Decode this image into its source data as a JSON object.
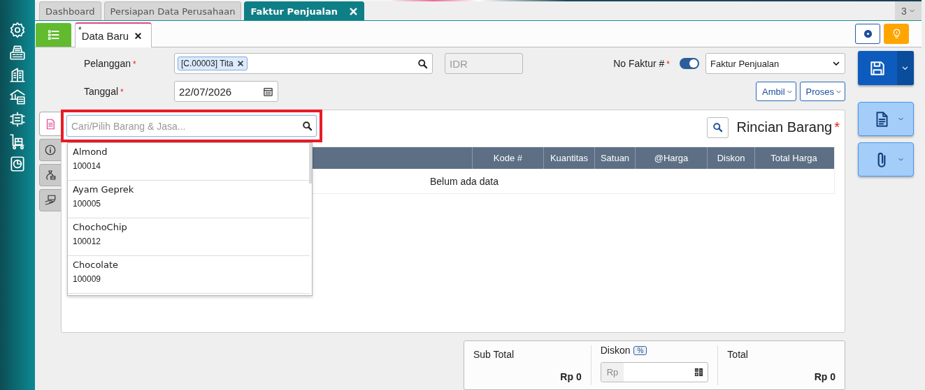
{
  "tabs": [
    {
      "label": "Dashboard",
      "selected": false
    },
    {
      "label": "Persiapan Data Perusahaan",
      "selected": false
    },
    {
      "label": "Faktur Penjualan",
      "selected": true
    }
  ],
  "tab_count": "3",
  "subtab": {
    "label": "Data Baru",
    "modified_mark": "*",
    "selected": true
  },
  "form": {
    "customer": {
      "label": "Pelanggan",
      "required_mark": "*",
      "tag": "[C.00003] Tita"
    },
    "currency": {
      "value": "IDR",
      "disabled": true
    },
    "invoice_no": {
      "label": "No Faktur #",
      "required_mark": "*",
      "auto": true,
      "value": "Faktur Penjualan"
    },
    "date": {
      "label": "Tanggal",
      "required_mark": "*",
      "value": "22/07/2026"
    }
  },
  "action_buttons": [
    "Ambil",
    "Proses"
  ],
  "side_tabs": [
    {
      "selected": true
    },
    {
      "selected": false
    },
    {
      "selected": false
    },
    {
      "selected": false
    }
  ],
  "items_panel": {
    "title": "Rincian Barang",
    "required_mark": "*",
    "columns": [
      "Kode #",
      "Kuantitas",
      "Satuan",
      "@Harga",
      "Diskon",
      "Total Harga"
    ],
    "empty_text": "Belum ada data"
  },
  "item_search": {
    "placeholder": "Cari/Pilih Barang & Jasa...",
    "highlighted": true,
    "results": [
      {
        "name": "Almond",
        "code": "100014"
      },
      {
        "name": "Ayam Geprek",
        "code": "100005"
      },
      {
        "name": "ChochoChip",
        "code": "100012"
      },
      {
        "name": "Chocolate",
        "code": "100009"
      }
    ]
  },
  "totals": {
    "subtotal": {
      "label": "Sub Total",
      "value": "Rp 0"
    },
    "discount": {
      "label": "Diskon",
      "mode": "%",
      "prefix": "Rp"
    },
    "total": {
      "label": "Total",
      "value": "Rp 0"
    }
  }
}
